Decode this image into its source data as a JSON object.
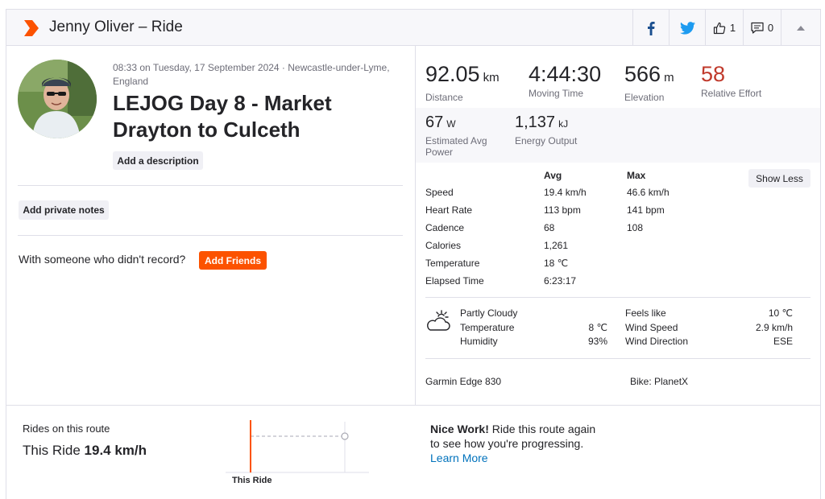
{
  "header": {
    "title": "Jenny Oliver – Ride",
    "kudos_count": "1",
    "comment_count": "0"
  },
  "activity": {
    "meta_line1": "08:33 on Tuesday, 17 September 2024 · Newcastle-under-Lyme,",
    "meta_line2": "England",
    "title": "LEJOG Day 8 - Market Drayton to Culceth",
    "add_description": "Add a description",
    "add_private_notes": "Add private notes",
    "with_someone": "With someone who didn't record?",
    "add_friends": "Add Friends"
  },
  "stats": {
    "distance": {
      "value": "92.05",
      "unit": "km",
      "label": "Distance"
    },
    "moving_time": {
      "value": "4:44:30",
      "label": "Moving Time"
    },
    "elevation": {
      "value": "566",
      "unit": "m",
      "label": "Elevation"
    },
    "relative_effort": {
      "value": "58",
      "label": "Relative Effort"
    },
    "power": {
      "value": "67",
      "unit": "W",
      "label_line1": "Estimated Avg",
      "label_line2": "Power"
    },
    "energy": {
      "value": "1,137",
      "unit": "kJ",
      "label": "Energy Output"
    }
  },
  "table": {
    "col_avg": "Avg",
    "col_max": "Max",
    "show_less": "Show Less",
    "rows": [
      {
        "label": "Speed",
        "avg": "19.4 km/h",
        "max": "46.6 km/h"
      },
      {
        "label": "Heart Rate",
        "avg": "113 bpm",
        "max": "141 bpm"
      },
      {
        "label": "Cadence",
        "avg": "68",
        "max": "108"
      },
      {
        "label": "Calories",
        "avg": "1,261",
        "max": ""
      },
      {
        "label": "Temperature",
        "avg": "18 ℃",
        "max": ""
      },
      {
        "label": "Elapsed Time",
        "avg": "6:23:17",
        "max": ""
      }
    ]
  },
  "weather": {
    "icon": "partly-cloudy-icon",
    "condition": "Partly Cloudy",
    "temperature_label": "Temperature",
    "temperature_value": "8 ℃",
    "humidity_label": "Humidity",
    "humidity_value": "93%",
    "feels_like_label": "Feels like",
    "feels_like_value": "10 ℃",
    "wind_speed_label": "Wind Speed",
    "wind_speed_value": "2.9 km/h",
    "wind_direction_label": "Wind Direction",
    "wind_direction_value": "ESE"
  },
  "devices": {
    "device": "Garmin Edge 830",
    "bike": "Bike: PlanetX"
  },
  "route": {
    "rides_label": "Rides on this route",
    "this_ride_prefix": "This Ride",
    "this_ride_value": "19.4 km/h",
    "chart_label": "This Ride",
    "nice_work": "Nice Work!",
    "nice_text": "Ride this route again to see how you're progressing.",
    "learn_more": "Learn More"
  },
  "colors": {
    "brand": "#fc5200",
    "relative_effort": "#c0392b",
    "link": "#0072bc",
    "facebook": "#1b4f8f",
    "twitter": "#1d9bf0"
  }
}
